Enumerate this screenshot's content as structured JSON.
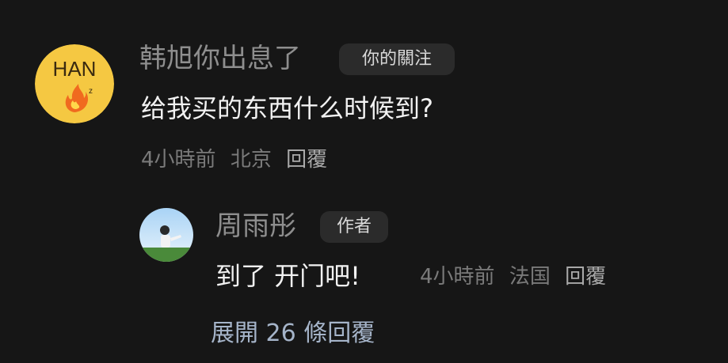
{
  "colors": {
    "background": "#161616",
    "name": "#8e8e8e",
    "meta": "#7a7a7a",
    "tag_bg": "#2b2b2b",
    "expand_link": "#a5b4c9"
  },
  "comment": {
    "avatar_icon": "han-fire-avatar-icon",
    "avatar_text": "HAN",
    "author": "韩旭你出息了",
    "tag": "你的關注",
    "text": "给我买的东西什么时候到?",
    "time": "4小時前",
    "location": "北京",
    "reply_label": "回覆"
  },
  "reply": {
    "avatar_icon": "person-sky-avatar-icon",
    "author": "周雨彤",
    "tag": "作者",
    "text": "到了 开门吧!",
    "time": "4小時前",
    "location": "法国",
    "reply_label": "回覆"
  },
  "expand_replies": "展開 26 條回覆"
}
